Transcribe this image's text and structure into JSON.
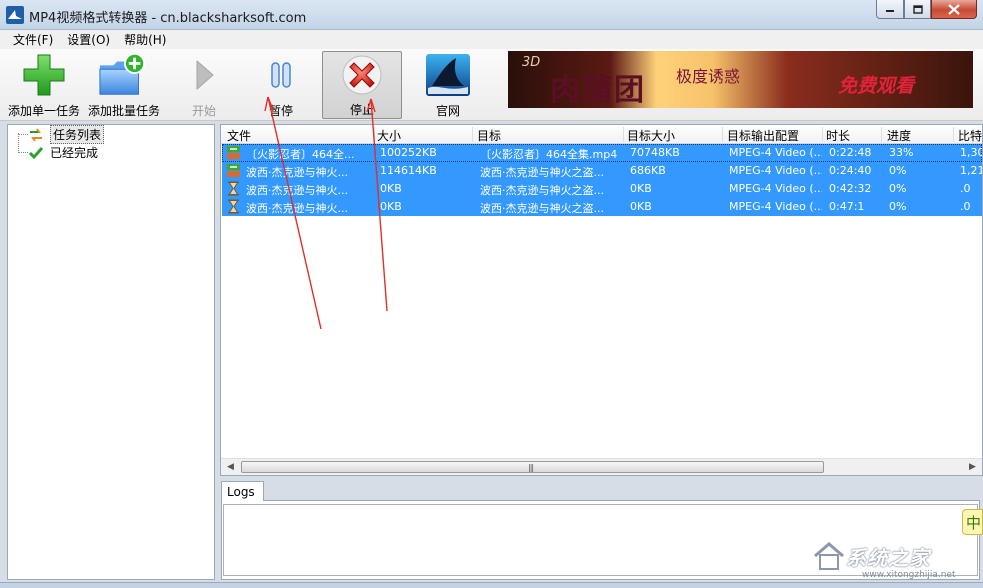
{
  "window": {
    "title": "MP4视频格式转换器 - cn.blacksharksoft.com",
    "controls": [
      "minimize-icon",
      "maximize-icon",
      "close-icon"
    ]
  },
  "menu": [
    "文件(F)",
    "设置(O)",
    "帮助(H)"
  ],
  "toolbar": {
    "add_single": "添加单一任务",
    "add_batch": "添加批量任务",
    "start": "开始",
    "pause": "暂停",
    "stop": "停止",
    "website": "官网",
    "start_disabled": true,
    "stop_pressed": true
  },
  "banner": {
    "tag": "3D",
    "title": "肉蒲团",
    "subtitle": "极度诱惑",
    "cta": "免费观看"
  },
  "tree": {
    "items": [
      {
        "label": "任务列表",
        "icon": "refresh-arrows-icon",
        "selected": true
      },
      {
        "label": "已经完成",
        "icon": "checkmark-icon",
        "selected": false
      }
    ]
  },
  "table": {
    "columns": [
      "文件",
      "大小",
      "目标",
      "目标大小",
      "目标输出配置",
      "时长",
      "进度",
      "比特"
    ],
    "rows": [
      {
        "file": "〔火影忍者〕464全...",
        "size": "100252KB",
        "target": "〔火影忍者〕464全集.mp4",
        "target_size": "70748KB",
        "config": "MPEG-4 Video (...",
        "duration": "0:22:48",
        "progress": "33%",
        "bitrate": "1,30",
        "icon": "converting-icon"
      },
      {
        "file": "波西·杰克逊与神火...",
        "size": "114614KB",
        "target": "波西·杰克逊与神火之盗...",
        "target_size": "686KB",
        "config": "MPEG-4 Video (...",
        "duration": "0:24:40",
        "progress": "0%",
        "bitrate": "1,21",
        "icon": "converting-icon"
      },
      {
        "file": "波西·杰克逊与神火...",
        "size": "0KB",
        "target": "波西·杰克逊与神火之盗...",
        "target_size": "0KB",
        "config": "MPEG-4 Video (...",
        "duration": "0:42:32",
        "progress": "0%",
        "bitrate": ".0",
        "icon": "hourglass-icon"
      },
      {
        "file": "波西·杰克逊与神火...",
        "size": "0KB",
        "target": "波西·杰克逊与神火之盗...",
        "target_size": "0KB",
        "config": "MPEG-4 Video (...",
        "duration": "0:47:1",
        "progress": "0%",
        "bitrate": ".0",
        "icon": "hourglass-icon"
      }
    ]
  },
  "logs": {
    "tab_label": "Logs",
    "content": ""
  },
  "ime_indicator": "中",
  "watermark": {
    "text": "系统之家",
    "url": "www.xitongzhijia.net"
  },
  "colors": {
    "selection": "#3399ff",
    "annotation": "#e0302a"
  }
}
